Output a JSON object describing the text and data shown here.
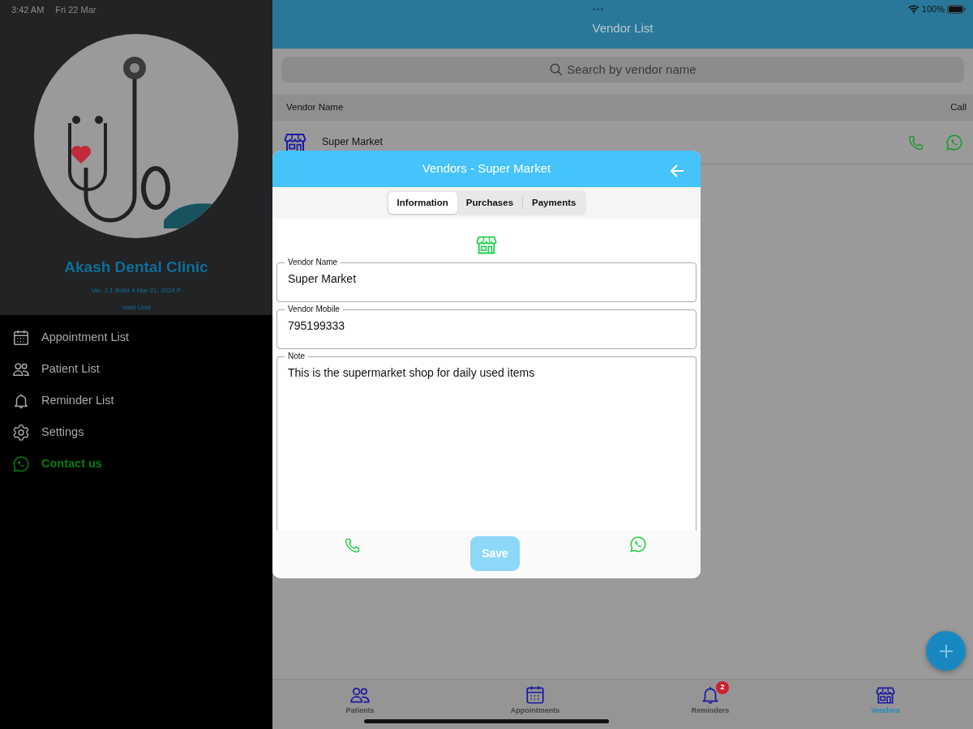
{
  "status_bar": {
    "time": "3:42 AM",
    "date": "Fri 22 Mar",
    "dots": "•••",
    "battery": "100%"
  },
  "sidebar": {
    "clinic_name": "Akash Dental Clinic",
    "version": "Ver. 1.1 Build 4 Mar 21, 2024 P",
    "validity": "Valid Until",
    "items": [
      {
        "label": "Appointment List",
        "kind": "nav"
      },
      {
        "label": "Patient List",
        "kind": "nav"
      },
      {
        "label": "Reminder List",
        "kind": "nav"
      },
      {
        "label": "Settings",
        "kind": "nav"
      },
      {
        "label": "Contact us",
        "kind": "contact"
      }
    ]
  },
  "header": {
    "title": "Vendor List"
  },
  "search": {
    "placeholder": "Search by vendor name"
  },
  "table": {
    "columns": [
      "Vendor Name",
      "Call"
    ],
    "rows": [
      {
        "name": "Super Market"
      }
    ]
  },
  "dialog": {
    "title": "Vendors - Super Market",
    "tabs": [
      {
        "label": "Information",
        "selected": true
      },
      {
        "label": "Purchases",
        "selected": false
      },
      {
        "label": "Payments",
        "selected": false
      }
    ],
    "fields": [
      {
        "label": "Vendor Name",
        "value": "Super Market",
        "kind": "input"
      },
      {
        "label": "Vendor Mobile",
        "value": "795199333",
        "kind": "input"
      },
      {
        "label": "Note",
        "value": "This is the supermarket shop for daily used items",
        "kind": "textarea"
      }
    ],
    "save_button": {
      "label": "Save",
      "disabled": true
    }
  },
  "tab_bar": [
    {
      "label": "Patients",
      "selected": false
    },
    {
      "label": "Appointments",
      "selected": false
    },
    {
      "label": "Reminders",
      "selected": false,
      "badge": "2"
    },
    {
      "label": "Vendors",
      "selected": true
    }
  ]
}
